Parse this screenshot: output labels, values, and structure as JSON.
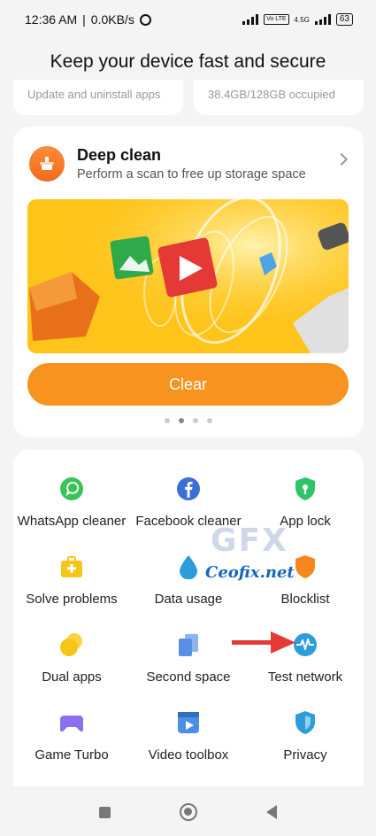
{
  "status": {
    "time": "12:36 AM",
    "separator": "|",
    "speed": "0.0KB/s",
    "volte": "Vo LTE",
    "net": "4.5G",
    "battery": "63"
  },
  "page": {
    "title": "Keep your device fast and secure"
  },
  "top_cards": {
    "left": "Update and uninstall apps",
    "right": "38.4GB/128GB occupied"
  },
  "deep_clean": {
    "title": "Deep clean",
    "subtitle": "Perform a scan to free up storage space",
    "button": "Clear",
    "pager": {
      "count": 4,
      "active_index": 1
    }
  },
  "tools": [
    {
      "label": "WhatsApp cleaner",
      "icon": "whatsapp-icon",
      "color": "#3cc25b"
    },
    {
      "label": "Facebook cleaner",
      "icon": "facebook-icon",
      "color": "#3b6fd6"
    },
    {
      "label": "App lock",
      "icon": "shield-lock-icon",
      "color": "#2fc36b"
    },
    {
      "label": "Solve problems",
      "icon": "toolbox-icon",
      "color": "#f5c518"
    },
    {
      "label": "Data usage",
      "icon": "water-drop-icon",
      "color": "#2d9cdb"
    },
    {
      "label": "Blocklist",
      "icon": "shield-icon",
      "color": "#f7861e"
    },
    {
      "label": "Dual apps",
      "icon": "dual-circles-icon",
      "color": "#f5c518"
    },
    {
      "label": "Second space",
      "icon": "stacked-squares-icon",
      "color": "#5b8ee6"
    },
    {
      "label": "Test network",
      "icon": "network-pulse-icon",
      "color": "#2d9cdb"
    },
    {
      "label": "Game Turbo",
      "icon": "gamepad-icon",
      "color": "#8b6ff0"
    },
    {
      "label": "Video toolbox",
      "icon": "video-icon",
      "color": "#4a90e2"
    },
    {
      "label": "Privacy",
      "icon": "privacy-shield-icon",
      "color": "#2d9cdb"
    }
  ],
  "watermark": {
    "brand": "GFX",
    "site": "Ceofix.net"
  },
  "colors": {
    "accent": "#f7931e",
    "banner": "#ffc41a",
    "arrow": "#e53935"
  }
}
